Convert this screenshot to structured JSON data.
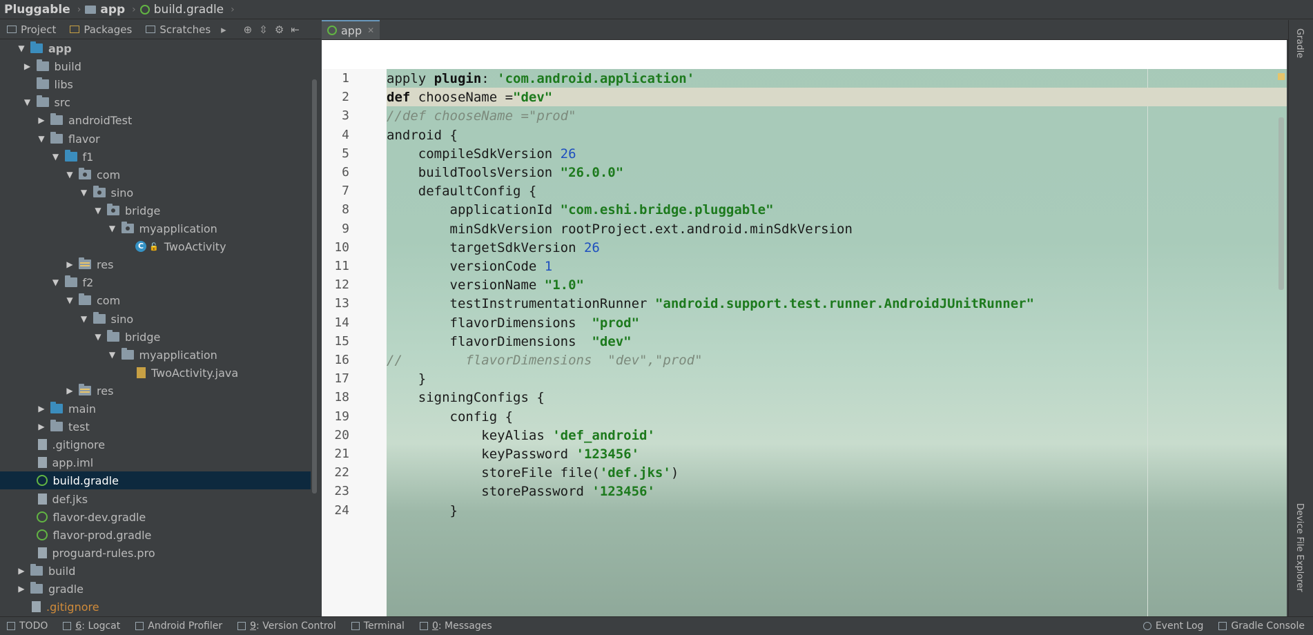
{
  "navbar": {
    "crumbs": [
      "Pluggable",
      "app",
      "build.gradle"
    ]
  },
  "project_view": {
    "tabs": [
      "Project",
      "Packages",
      "Scratches"
    ],
    "tree": [
      {
        "label": "app",
        "depth": 1,
        "icon": "module-folder",
        "arrow": "down",
        "bold": true
      },
      {
        "label": "build",
        "depth": 2,
        "icon": "folder",
        "arrow": "right"
      },
      {
        "label": "libs",
        "depth": 2,
        "icon": "folder",
        "arrow": "none"
      },
      {
        "label": "src",
        "depth": 2,
        "icon": "folder",
        "arrow": "down"
      },
      {
        "label": "androidTest",
        "depth": 3,
        "icon": "folder",
        "arrow": "right"
      },
      {
        "label": "flavor",
        "depth": 3,
        "icon": "folder",
        "arrow": "down"
      },
      {
        "label": "f1",
        "depth": 4,
        "icon": "source-folder",
        "arrow": "down"
      },
      {
        "label": "com",
        "depth": 5,
        "icon": "package",
        "arrow": "down"
      },
      {
        "label": "sino",
        "depth": 6,
        "icon": "package",
        "arrow": "down"
      },
      {
        "label": "bridge",
        "depth": 7,
        "icon": "package",
        "arrow": "down"
      },
      {
        "label": "myapplication",
        "depth": 8,
        "icon": "package",
        "arrow": "down"
      },
      {
        "label": "TwoActivity",
        "depth": 9,
        "icon": "class",
        "arrow": "none"
      },
      {
        "label": "res",
        "depth": 5,
        "icon": "res-folder",
        "arrow": "right"
      },
      {
        "label": "f2",
        "depth": 4,
        "icon": "folder",
        "arrow": "down"
      },
      {
        "label": "com",
        "depth": 5,
        "icon": "folder",
        "arrow": "down"
      },
      {
        "label": "sino",
        "depth": 6,
        "icon": "folder",
        "arrow": "down"
      },
      {
        "label": "bridge",
        "depth": 7,
        "icon": "folder",
        "arrow": "down"
      },
      {
        "label": "myapplication",
        "depth": 8,
        "icon": "folder",
        "arrow": "down"
      },
      {
        "label": "TwoActivity.java",
        "depth": 9,
        "icon": "java-file",
        "arrow": "none"
      },
      {
        "label": "res",
        "depth": 5,
        "icon": "res-folder",
        "arrow": "right"
      },
      {
        "label": "main",
        "depth": 3,
        "icon": "source-folder",
        "arrow": "right"
      },
      {
        "label": "test",
        "depth": 3,
        "icon": "folder",
        "arrow": "right"
      },
      {
        "label": ".gitignore",
        "depth": 2,
        "icon": "file",
        "arrow": "none"
      },
      {
        "label": "app.iml",
        "depth": 2,
        "icon": "file",
        "arrow": "none"
      },
      {
        "label": "build.gradle",
        "depth": 2,
        "icon": "gradle-file",
        "arrow": "none",
        "selected": true
      },
      {
        "label": "def.jks",
        "depth": 2,
        "icon": "file",
        "arrow": "none"
      },
      {
        "label": "flavor-dev.gradle",
        "depth": 2,
        "icon": "gradle-file",
        "arrow": "none"
      },
      {
        "label": "flavor-prod.gradle",
        "depth": 2,
        "icon": "gradle-file",
        "arrow": "none"
      },
      {
        "label": "proguard-rules.pro",
        "depth": 2,
        "icon": "file",
        "arrow": "none"
      },
      {
        "label": "build",
        "depth": 1,
        "icon": "folder",
        "arrow": "right"
      },
      {
        "label": "gradle",
        "depth": 1,
        "icon": "folder",
        "arrow": "right"
      },
      {
        "label": ".gitignore",
        "depth": 1,
        "icon": "file",
        "arrow": "none",
        "ignored": true
      }
    ]
  },
  "editor": {
    "tab_label": "app",
    "lines": [
      {
        "n": "1",
        "parts": [
          [
            "txt",
            "apply "
          ],
          [
            "kw",
            "plugin"
          ],
          [
            "txt",
            ": "
          ],
          [
            "str",
            "'com.android.application'"
          ]
        ]
      },
      {
        "n": "2",
        "current": true,
        "parts": [
          [
            "kw",
            "def "
          ],
          [
            "txt",
            "chooseName ="
          ],
          [
            "str",
            "\"dev\""
          ]
        ]
      },
      {
        "n": "3",
        "parts": [
          [
            "cmt",
            "//def chooseName =\"prod\""
          ]
        ]
      },
      {
        "n": "4",
        "parts": [
          [
            "txt",
            "android {"
          ]
        ]
      },
      {
        "n": "5",
        "parts": [
          [
            "txt",
            "    compileSdkVersion "
          ],
          [
            "num",
            "26"
          ]
        ]
      },
      {
        "n": "6",
        "parts": [
          [
            "txt",
            "    buildToolsVersion "
          ],
          [
            "str",
            "\"26.0.0\""
          ]
        ]
      },
      {
        "n": "7",
        "parts": [
          [
            "txt",
            "    defaultConfig {"
          ]
        ]
      },
      {
        "n": "8",
        "parts": [
          [
            "txt",
            "        applicationId "
          ],
          [
            "str",
            "\"com.eshi.bridge.pluggable\""
          ]
        ]
      },
      {
        "n": "9",
        "parts": [
          [
            "txt",
            "        minSdkVersion rootProject.ext.android.minSdkVersion"
          ]
        ]
      },
      {
        "n": "10",
        "parts": [
          [
            "txt",
            "        targetSdkVersion "
          ],
          [
            "num",
            "26"
          ]
        ]
      },
      {
        "n": "11",
        "parts": [
          [
            "txt",
            "        versionCode "
          ],
          [
            "num",
            "1"
          ]
        ]
      },
      {
        "n": "12",
        "parts": [
          [
            "txt",
            "        versionName "
          ],
          [
            "str",
            "\"1.0\""
          ]
        ]
      },
      {
        "n": "13",
        "parts": [
          [
            "txt",
            "        testInstrumentationRunner "
          ],
          [
            "str",
            "\"android.support.test.runner.AndroidJUnitRunner\""
          ]
        ]
      },
      {
        "n": "14",
        "parts": [
          [
            "txt",
            "        flavorDimensions  "
          ],
          [
            "str",
            "\"prod\""
          ]
        ]
      },
      {
        "n": "15",
        "parts": [
          [
            "txt",
            "        flavorDimensions  "
          ],
          [
            "str",
            "\"dev\""
          ]
        ]
      },
      {
        "n": "16",
        "parts": [
          [
            "cmt",
            "//        flavorDimensions  \"dev\",\"prod\""
          ]
        ]
      },
      {
        "n": "17",
        "parts": [
          [
            "txt",
            "    }"
          ]
        ]
      },
      {
        "n": "18",
        "parts": [
          [
            "txt",
            "    signingConfigs {"
          ]
        ]
      },
      {
        "n": "19",
        "parts": [
          [
            "txt",
            "        config {"
          ]
        ]
      },
      {
        "n": "20",
        "parts": [
          [
            "txt",
            "            keyAlias "
          ],
          [
            "str",
            "'def_android'"
          ]
        ]
      },
      {
        "n": "21",
        "parts": [
          [
            "txt",
            "            keyPassword "
          ],
          [
            "str",
            "'123456'"
          ]
        ]
      },
      {
        "n": "22",
        "parts": [
          [
            "txt",
            "            storeFile file("
          ],
          [
            "str",
            "'def.jks'"
          ],
          [
            "txt",
            ")"
          ]
        ]
      },
      {
        "n": "23",
        "parts": [
          [
            "txt",
            "            storePassword "
          ],
          [
            "str",
            "'123456'"
          ]
        ]
      },
      {
        "n": "24",
        "parts": [
          [
            "txt",
            "        }"
          ]
        ]
      }
    ]
  },
  "right_strip": {
    "top_label": "Gradle",
    "bottom_label": "Device File Explorer"
  },
  "bottom_bar": {
    "todo": "TODO",
    "logcat_num": "6",
    "logcat": ": Logcat",
    "profiler": "Android Profiler",
    "vc_num": "9",
    "vc": ": Version Control",
    "terminal": "Terminal",
    "messages_num": "0",
    "messages": ": Messages",
    "event_log": "Event Log",
    "gradle_console": "Gradle Console"
  },
  "colors": {
    "ide_bg": "#3c3f41",
    "selection": "#0d293e",
    "string": "#1d7a1d",
    "number": "#1e4fbf",
    "comment": "#7c8a7c"
  }
}
